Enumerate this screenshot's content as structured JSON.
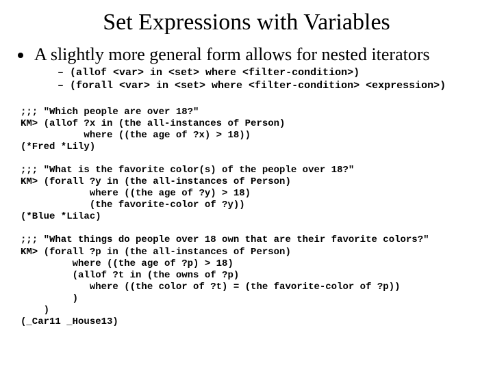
{
  "title": "Set Expressions with Variables",
  "bullet": {
    "text": "A slightly more general form allows for nested iterators",
    "sub": [
      "(allof <var> in <set> where <filter-condition>)",
      "(forall <var> in <set> where <filter-condition> <expression>)"
    ]
  },
  "code": ";;; \"Which people are over 18?\"\nKM> (allof ?x in (the all-instances of Person)\n           where ((the age of ?x) > 18))\n(*Fred *Lily)\n\n;;; \"What is the favorite color(s) of the people over 18?\"\nKM> (forall ?y in (the all-instances of Person)\n            where ((the age of ?y) > 18)\n            (the favorite-color of ?y))\n(*Blue *Lilac)\n\n;;; \"What things do people over 18 own that are their favorite colors?\"\nKM> (forall ?p in (the all-instances of Person)\n         where ((the age of ?p) > 18)\n         (allof ?t in (the owns of ?p)\n            where ((the color of ?t) = (the favorite-color of ?p))\n         )\n    )\n(_Car11 _House13)"
}
